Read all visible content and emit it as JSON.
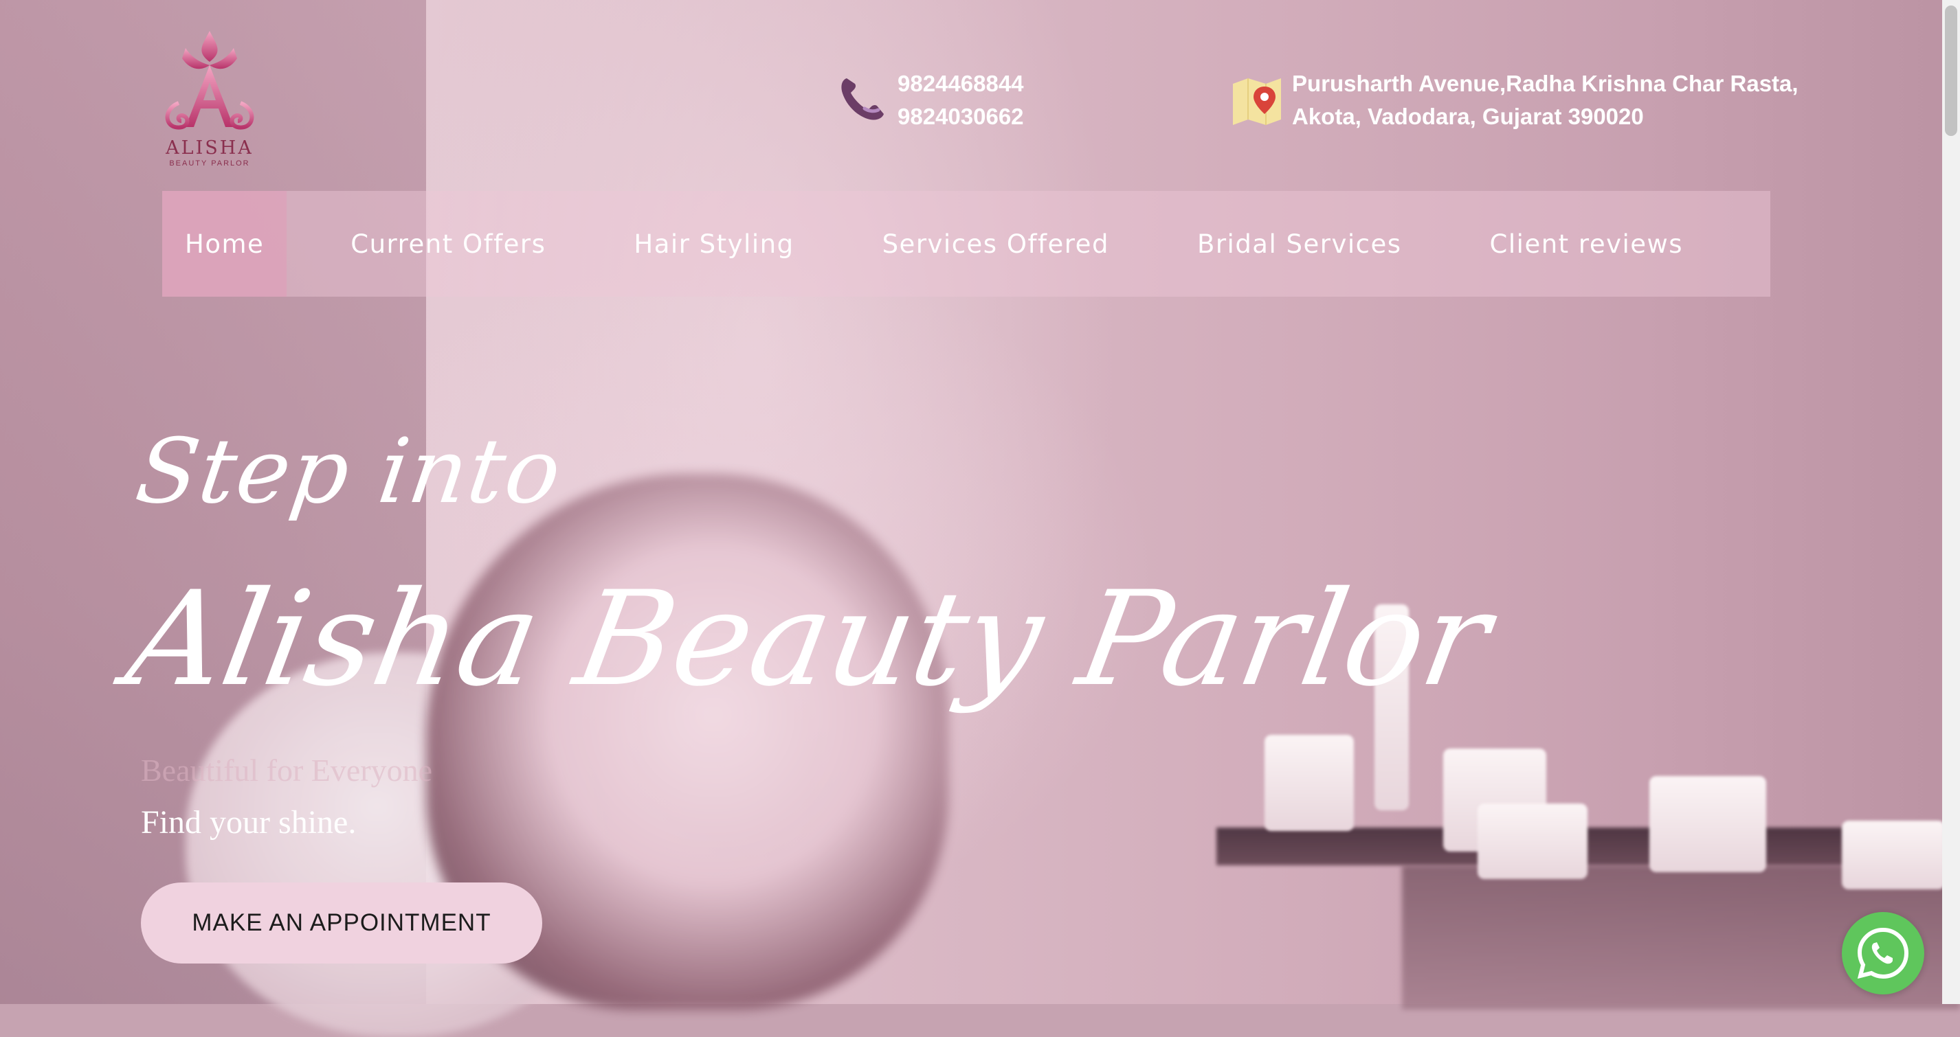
{
  "brand": {
    "logo_name": "ALISHA",
    "logo_tagline": "BEAUTY PARLOR"
  },
  "contact": {
    "phones": [
      "9824468844",
      "9824030662"
    ],
    "address_line1": "Purusharth Avenue,Radha Krishna Char Rasta,",
    "address_line2": "Akota, Vadodara, Gujarat 390020"
  },
  "nav": {
    "items": [
      {
        "label": "Home",
        "active": true
      },
      {
        "label": "Current Offers"
      },
      {
        "label": "Hair Styling"
      },
      {
        "label": "Services Offered"
      },
      {
        "label": "Bridal Services"
      },
      {
        "label": "Client reviews"
      }
    ]
  },
  "hero": {
    "kicker": "Step into",
    "title": "Alisha Beauty Parlor",
    "faded_text": "Beautiful for Everyone",
    "tagline": "Find your shine.",
    "cta_label": "MAKE AN APPOINTMENT"
  },
  "colors": {
    "accent": "#f0d2df",
    "nav_active": "#dda0ba",
    "whatsapp": "#5fc65c",
    "phone_icon": "#6b3d66",
    "map_pin": "#d9443a"
  },
  "icons": [
    "phone-icon",
    "map-icon",
    "whatsapp-icon"
  ]
}
